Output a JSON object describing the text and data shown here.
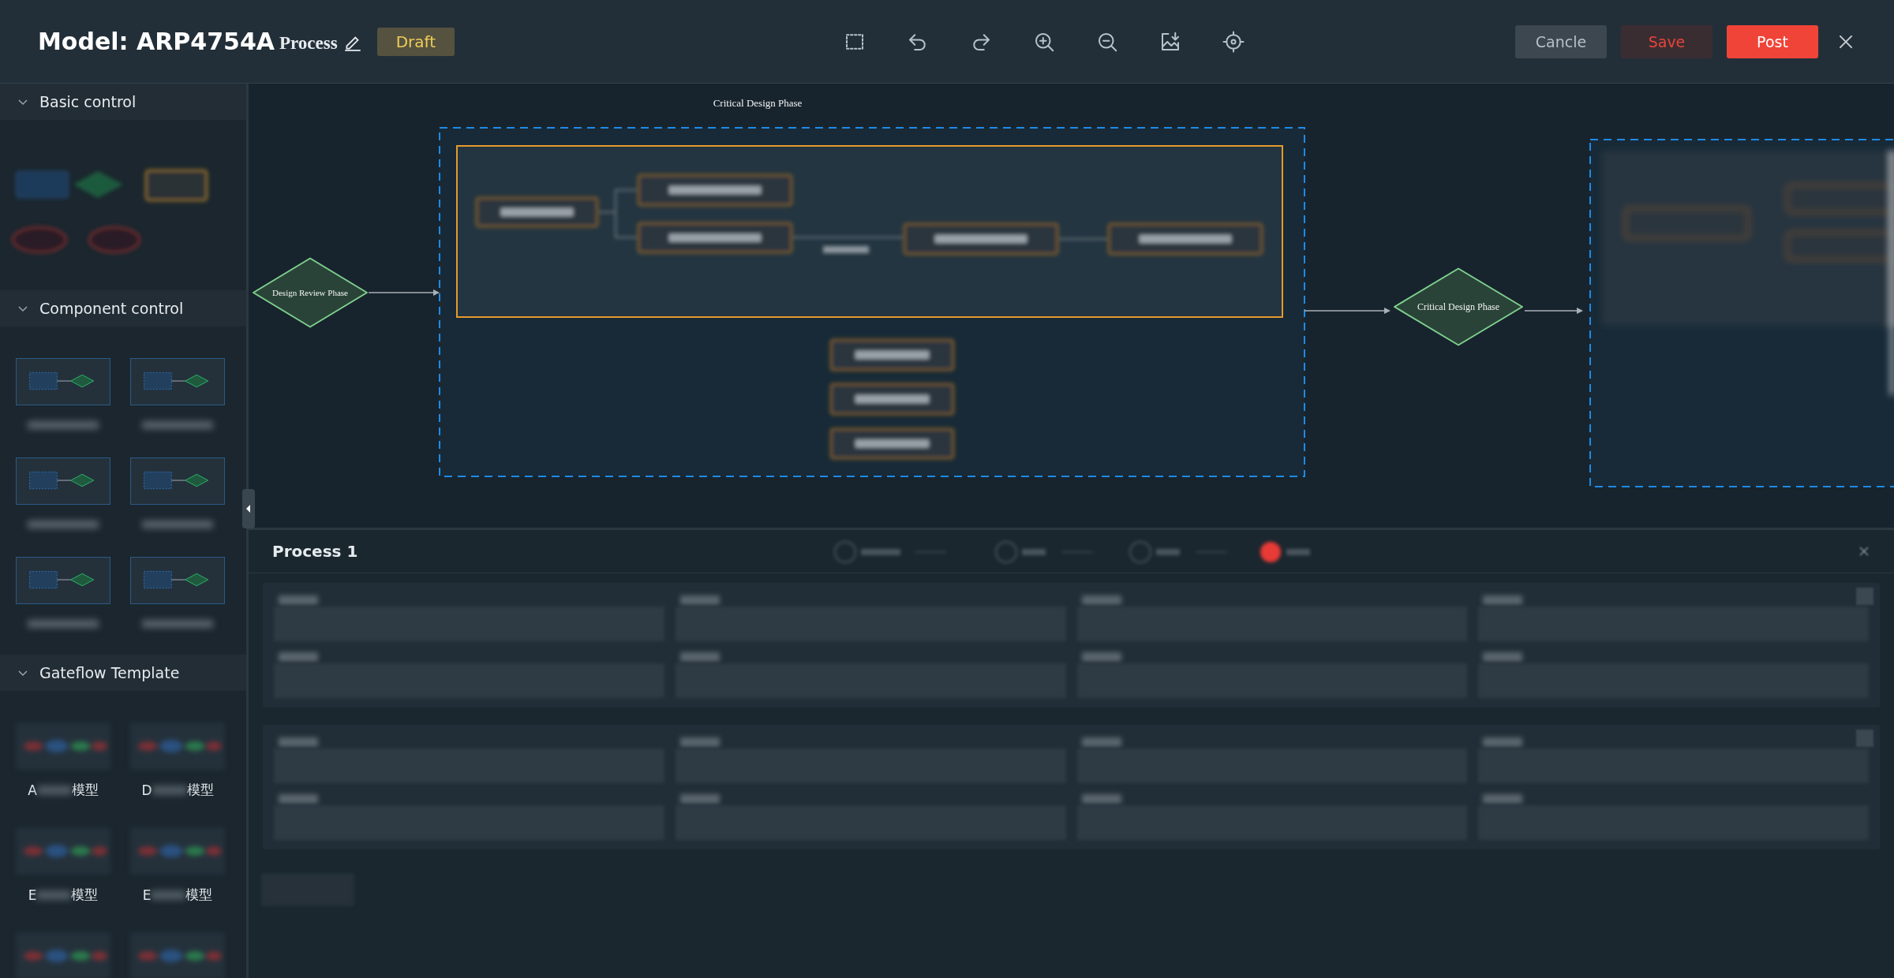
{
  "header": {
    "title": "Model: ARP4754A",
    "subtitle": "Process",
    "status": "Draft"
  },
  "buttons": [
    {
      "label": "Cancle",
      "kind": "secondary"
    },
    {
      "label": "Save",
      "kind": "danger"
    },
    {
      "label": "Post",
      "kind": "primary"
    }
  ],
  "sidebar": {
    "sections": [
      {
        "title": "Basic control",
        "kind": "basic",
        "expanded": true
      },
      {
        "title": "Component control",
        "kind": "component",
        "expanded": true
      },
      {
        "title": "Gateflow Template",
        "kind": "template",
        "expanded": true,
        "items": [
          {
            "prefix": "A",
            "suffix": "模型"
          },
          {
            "prefix": "D",
            "suffix": "模型"
          },
          {
            "prefix": "E",
            "suffix": "模型"
          },
          {
            "prefix": "E",
            "suffix": "模型"
          }
        ]
      }
    ]
  },
  "canvas": {
    "phase_label": "Critical Design Phase",
    "gates": [
      {
        "label": "Design Review Phase"
      },
      {
        "label": "Critical Design Phase"
      }
    ]
  },
  "process_panel": {
    "title": "Process 1"
  }
}
